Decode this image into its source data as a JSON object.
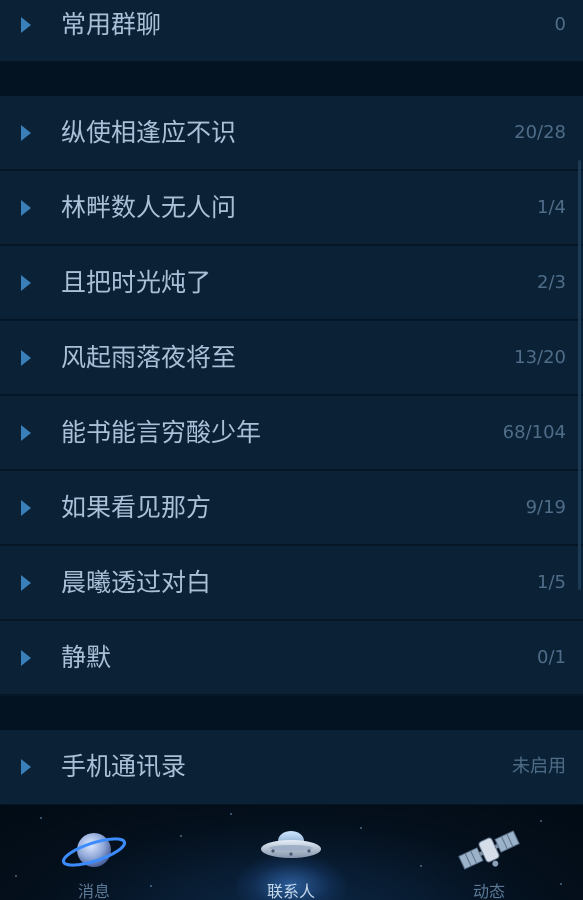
{
  "groups": [
    {
      "label": "常用群聊",
      "count": "0"
    },
    {
      "label": "纵使相逢应不识",
      "count": "20/28"
    },
    {
      "label": "林畔数人无人问",
      "count": "1/4"
    },
    {
      "label": "且把时光炖了",
      "count": "2/3"
    },
    {
      "label": "风起雨落夜将至",
      "count": "13/20"
    },
    {
      "label": "能书能言穷酸少年",
      "count": "68/104"
    },
    {
      "label": "如果看见那方",
      "count": "9/19"
    },
    {
      "label": "晨曦透过对白",
      "count": "1/5"
    },
    {
      "label": "静默",
      "count": "0/1"
    },
    {
      "label": "手机通讯录",
      "count": "未启用"
    }
  ],
  "tabs": [
    {
      "label": "消息",
      "icon": "planet-icon"
    },
    {
      "label": "联系人",
      "icon": "ufo-icon",
      "active": true
    },
    {
      "label": "动态",
      "icon": "satellite-icon"
    }
  ],
  "colors": {
    "row_bg": "#0a2136",
    "label": "#a9c0d6",
    "count": "#4f6d88",
    "arrow": "#3a7fb8"
  }
}
